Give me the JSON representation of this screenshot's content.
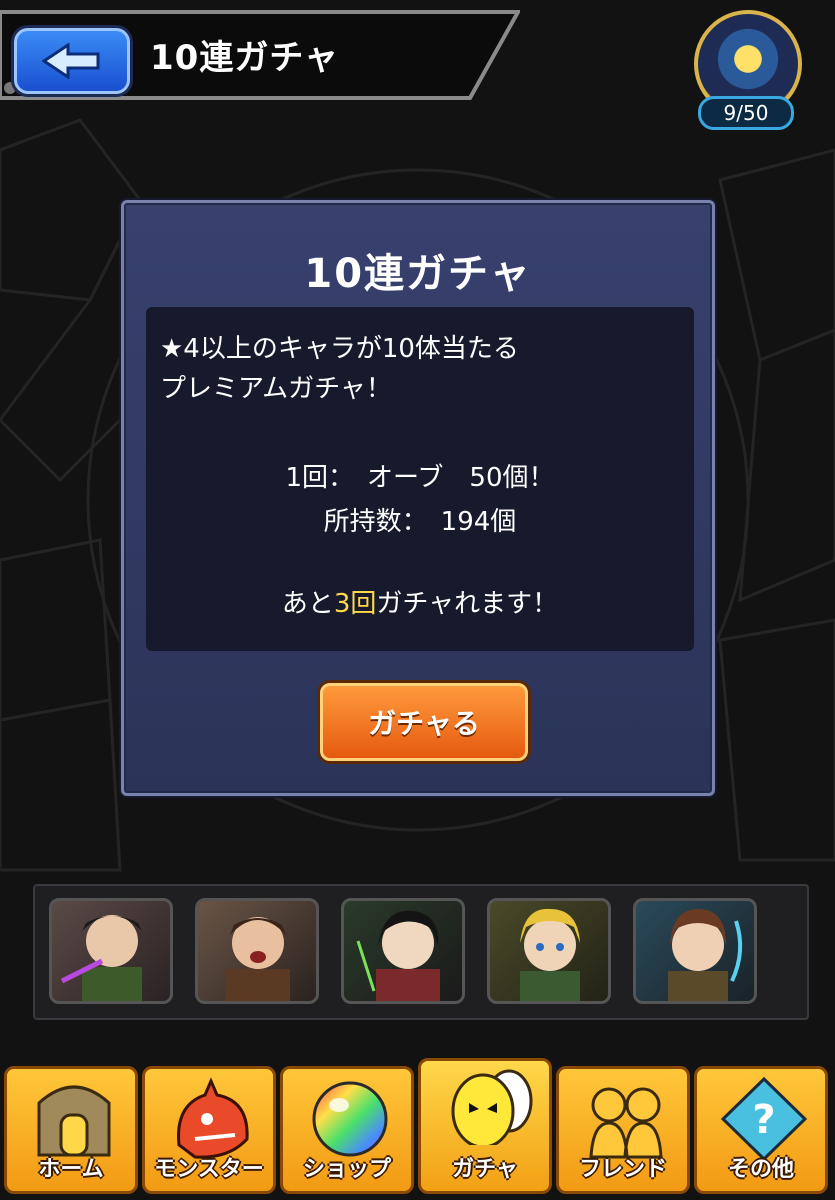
{
  "header": {
    "title": "10連ガチャ",
    "stamina": "9/50"
  },
  "panel": {
    "title": "10連ガチャ",
    "description_line1": "★4以上のキャラが10体当たる",
    "description_line2": "プレミアムガチャ！",
    "cost": "1回：　オーブ　50個！",
    "owned": "所持数：　194個",
    "remaining_prefix": "あと",
    "remaining_count": "3回",
    "remaining_suffix": "ガチャれます！",
    "button_label": "ガチャる"
  },
  "characters": [
    {
      "icon": "character-1-icon"
    },
    {
      "icon": "character-2-icon"
    },
    {
      "icon": "character-3-icon"
    },
    {
      "icon": "character-4-icon"
    },
    {
      "icon": "character-5-icon"
    }
  ],
  "nav": {
    "items": [
      {
        "label": "ホーム",
        "icon": "home-icon"
      },
      {
        "label": "モンスター",
        "icon": "monster-icon"
      },
      {
        "label": "ショップ",
        "icon": "shop-icon"
      },
      {
        "label": "ガチャ",
        "icon": "gacha-egg-icon"
      },
      {
        "label": "フレンド",
        "icon": "friend-icon"
      },
      {
        "label": "その他",
        "icon": "other-icon"
      }
    ]
  },
  "colors": {
    "accent": "#ffd84a",
    "panel": "#2b3358",
    "button": "#e55a10",
    "nav": "#f29a14"
  }
}
